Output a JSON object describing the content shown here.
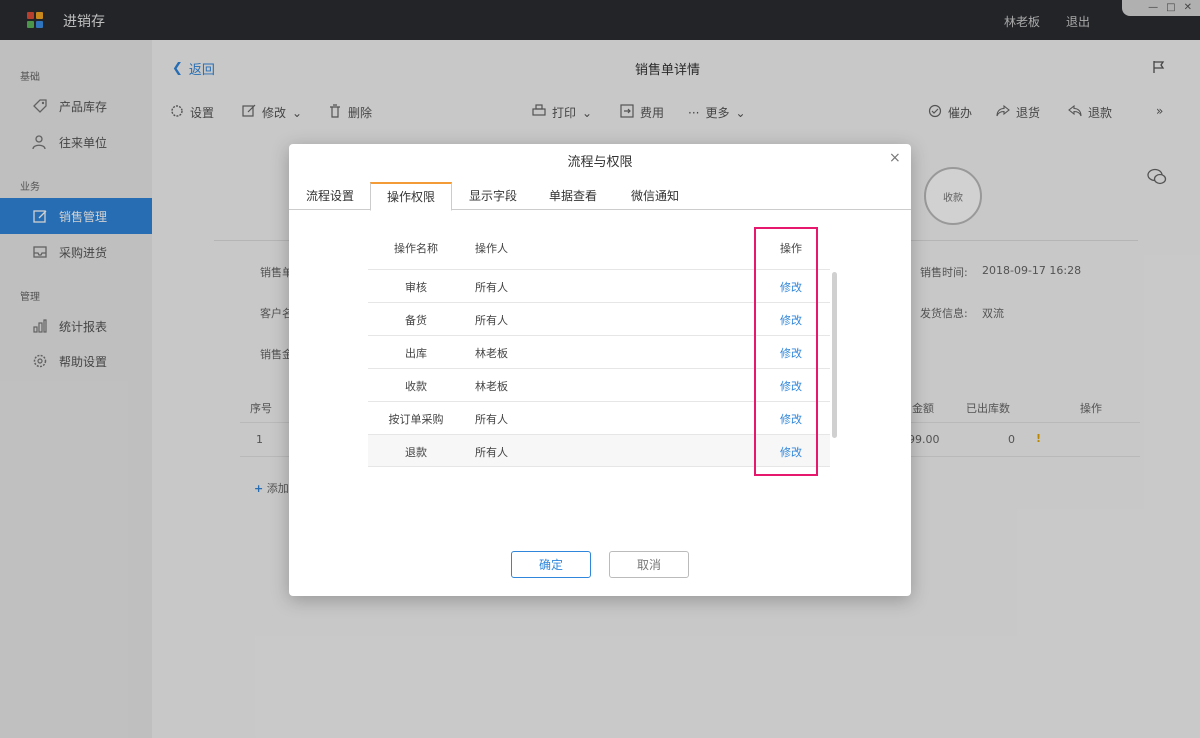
{
  "app": {
    "title": "进销存",
    "user": "林老板",
    "logout": "退出",
    "logo_colors": [
      "#e04e39",
      "#f5a623",
      "#5cb85c",
      "#3a8ee6"
    ],
    "window_controls": [
      "—",
      "□",
      "✕"
    ]
  },
  "sidebar": {
    "groups": [
      {
        "label": "基础"
      },
      {
        "label": "业务"
      },
      {
        "label": "管理"
      }
    ],
    "items": [
      {
        "label": "产品库存",
        "icon": "tag-icon"
      },
      {
        "label": "往来单位",
        "icon": "contacts-icon"
      },
      {
        "label": "销售管理",
        "icon": "edit-icon",
        "active": true
      },
      {
        "label": "采购进货",
        "icon": "inbox-icon"
      },
      {
        "label": "统计报表",
        "icon": "bar-chart-icon"
      },
      {
        "label": "帮助设置",
        "icon": "gear-icon"
      }
    ],
    "active_color": "#2f86db"
  },
  "page": {
    "back": "返回",
    "title": "销售单详情",
    "toolbar": {
      "settings": "设置",
      "edit": "修改",
      "delete": "删除",
      "print": "打印",
      "fee": "费用",
      "more": "更多",
      "urge": "催办",
      "return_goods": "退货",
      "refund": "退款"
    },
    "status_badge": "收款",
    "info": {
      "row1_left": "销售单",
      "row2_left": "客户名",
      "row3_left": "销售金",
      "sale_time_label": "销售时间:",
      "sale_time_value": "2018-09-17 16:28",
      "ship_label": "发货信息:",
      "ship_value": "双流"
    },
    "table": {
      "col_index": "序号",
      "col_amount": "金额",
      "col_out_qty": "已出库数",
      "col_action": "操作",
      "row_index": "1",
      "row_amount": "99.00",
      "row_out_qty": "0",
      "warn": "!"
    },
    "add": "添加"
  },
  "modal": {
    "title": "流程与权限",
    "close": "×",
    "tabs": [
      {
        "label": "流程设置"
      },
      {
        "label": "操作权限",
        "active": true
      },
      {
        "label": "显示字段"
      },
      {
        "label": "单据查看"
      },
      {
        "label": "微信通知"
      }
    ],
    "headers": {
      "name": "操作名称",
      "operator": "操作人",
      "action": "操作"
    },
    "rows": [
      {
        "name": "审核",
        "operator": "所有人",
        "action": "修改"
      },
      {
        "name": "备货",
        "operator": "所有人",
        "action": "修改"
      },
      {
        "name": "出库",
        "operator": "林老板",
        "action": "修改"
      },
      {
        "name": "收款",
        "operator": "林老板",
        "action": "修改"
      },
      {
        "name": "按订单采购",
        "operator": "所有人",
        "action": "修改"
      },
      {
        "name": "退款",
        "operator": "所有人",
        "action": "修改"
      }
    ],
    "ok": "确定",
    "cancel": "取消",
    "accent_tab": "#f29b37",
    "highlight_color": "#e5186e"
  }
}
